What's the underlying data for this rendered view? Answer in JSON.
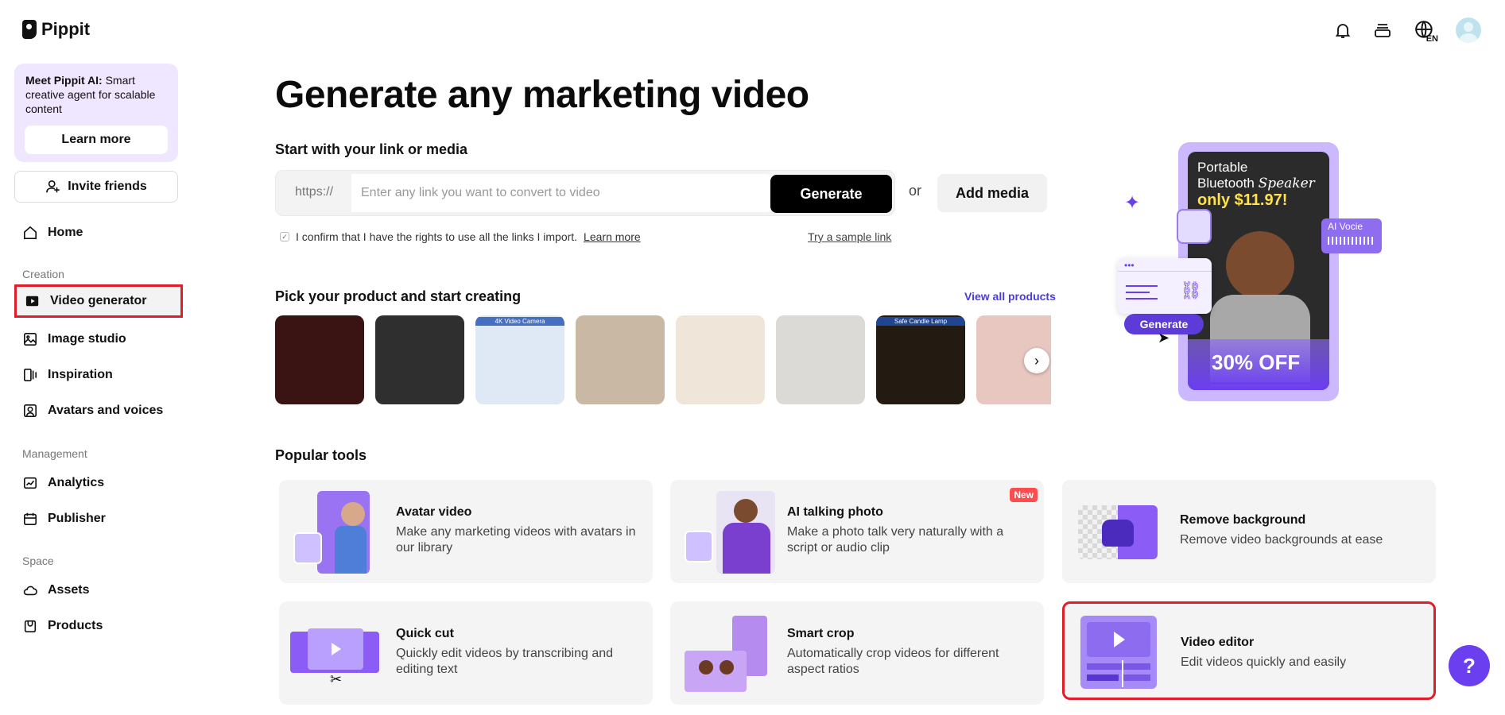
{
  "app": {
    "name": "Pippit"
  },
  "promo": {
    "title": "Meet Pippit AI:",
    "text": "Smart creative agent for scalable content",
    "button": "Learn more"
  },
  "invite": {
    "label": "Invite friends"
  },
  "nav": {
    "home": "Home",
    "section_creation": "Creation",
    "video_generator": "Video generator",
    "image_studio": "Image studio",
    "inspiration": "Inspiration",
    "avatars": "Avatars and voices",
    "section_management": "Management",
    "analytics": "Analytics",
    "publisher": "Publisher",
    "section_space": "Space",
    "assets": "Assets",
    "products": "Products"
  },
  "topbar": {
    "lang": "EN"
  },
  "main": {
    "title": "Generate any marketing video",
    "link_heading": "Start with your link or media",
    "https_prefix": "https://",
    "link_placeholder": "Enter any link you want to convert to video",
    "generate": "Generate",
    "or": "or",
    "add_media": "Add media",
    "confirm_text": "I confirm that I have the rights to use all the links I import.",
    "confirm_link": "Learn more",
    "sample_link": "Try a sample link",
    "pick_heading": "Pick your product and start creating",
    "view_all": "View all products",
    "popular_heading": "Popular tools"
  },
  "products": [
    {
      "name": "glass",
      "color": "#3a1313"
    },
    {
      "name": "food-trays",
      "color": "#2f2f2f"
    },
    {
      "name": "camera-kit",
      "color": "#dfe8f5",
      "label": "4K Video Camera"
    },
    {
      "name": "person-reading",
      "color": "#c9b8a3"
    },
    {
      "name": "handbag",
      "color": "#efe5d8"
    },
    {
      "name": "podcaster",
      "color": "#dcdad7"
    },
    {
      "name": "candle-lamp",
      "color": "#231a12",
      "label": "Safe Candle Lamp"
    },
    {
      "name": "makeup",
      "color": "#e7c7bf"
    }
  ],
  "tools": [
    {
      "title": "Avatar video",
      "desc": "Make any marketing videos with avatars in our library"
    },
    {
      "title": "AI talking photo",
      "desc": "Make a photo talk very naturally with a script or audio clip",
      "badge": "New"
    },
    {
      "title": "Remove background",
      "desc": "Remove video backgrounds at ease"
    },
    {
      "title": "Quick cut",
      "desc": "Quickly edit videos by transcribing and editing text"
    },
    {
      "title": "Smart crop",
      "desc": "Automatically crop videos for different aspect ratios"
    },
    {
      "title": "Video editor",
      "desc": "Edit videos quickly and easily"
    }
  ],
  "hero": {
    "line1": "Portable",
    "line2": "Bluetooth",
    "line2b": "Speaker",
    "price": "only $11.97!",
    "discount": "30% OFF",
    "generate": "Generate",
    "voice": "AI Vocie"
  },
  "colors": {
    "accent": "#6b3ef0",
    "highlight": "#e11d2a",
    "link": "#4b3be0"
  }
}
